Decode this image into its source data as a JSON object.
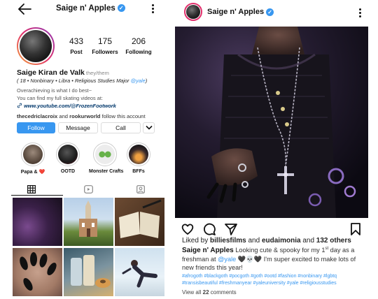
{
  "profile": {
    "username": "Saige n' Apples",
    "stats": [
      {
        "value": "433",
        "label": "Post"
      },
      {
        "value": "175",
        "label": "Followers"
      },
      {
        "value": "206",
        "label": "Following"
      }
    ],
    "full_name": "Saige Kiran de Valk",
    "pronouns": "they/them",
    "bio_line1_a": "( 18 • Nonbinary • Libra • Religious Studies Major ",
    "bio_line1_mention": "@yale",
    "bio_line1_b": ")",
    "bio_line2": "Overachieving is what I do best~",
    "bio_line3": "You can find my full skating videos at:",
    "bio_link": "www.youtube.com/@FrozenFootwork",
    "followed_by_user1": "thecedriclacroix",
    "followed_by_and": " and ",
    "followed_by_user2": "rookurworld",
    "followed_by_suffix": " follow this account",
    "buttons": {
      "follow": "Follow",
      "message": "Message",
      "call": "Call"
    },
    "highlights": [
      {
        "label": "Papa & ",
        "emoji": "❤️"
      },
      {
        "label": "OOTD"
      },
      {
        "label": "Monster Crafts"
      },
      {
        "label": "BFFs"
      }
    ]
  },
  "post": {
    "username": "Saige n' Apples",
    "liked_prefix": "Liked by ",
    "liked_user1": "billiesfilms",
    "liked_mid": " and ",
    "liked_user2": "eudaimonia",
    "liked_mid2": " and ",
    "liked_count": "132 others",
    "caption_user": "Saige n' Apples",
    "caption_line1": " Looking cute & spooky for my 1",
    "caption_sup": "st",
    "caption_line1_end": " day as a",
    "caption_line2_a": "freshman at ",
    "caption_line2_mention": "@yale",
    "caption_line2_b": " 🖤💀🖤 I'm super excited to make lots of",
    "caption_line3": "new friends this year!",
    "hashtags_line1": "#afrogoth #blackgoth #pocgoth #goth #ootd #fashion #nonbinary #lgbtq",
    "hashtags_line2": "#transisbeautiful #freshmanyear #yaleuniversity #yale #religiousstudies",
    "comments_prefix": "View all ",
    "comments_count": "22",
    "comments_suffix": " comments"
  },
  "colors": {
    "accent_blue": "#3897f0",
    "link_navy": "#00376b",
    "story_gradient": [
      "#f2a33a",
      "#e1306c",
      "#8a3ab9"
    ]
  },
  "icons": [
    "back-arrow-icon",
    "verified-icon",
    "more-options-icon",
    "grid-icon",
    "reels-icon",
    "tagged-icon",
    "chevron-down-icon",
    "heart-icon",
    "comment-icon",
    "share-icon",
    "bookmark-icon"
  ]
}
